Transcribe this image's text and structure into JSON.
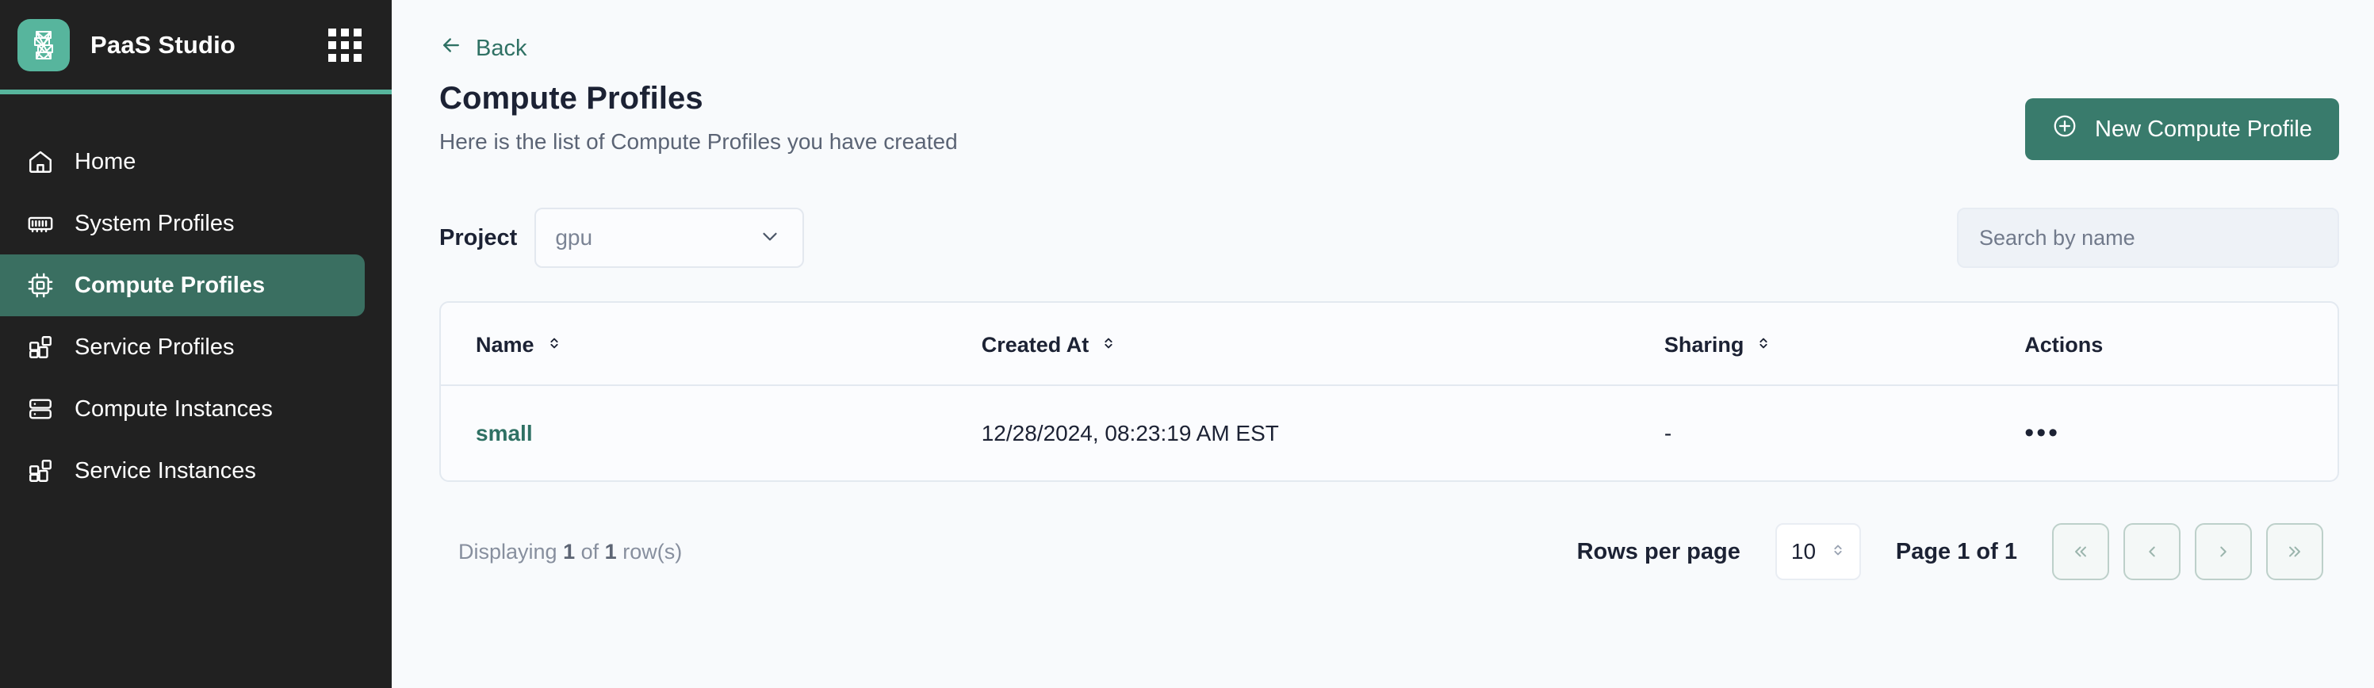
{
  "brand": {
    "name": "PaaS Studio",
    "logo_icon": "mesh-logo-icon",
    "apps_icon": "apps-grid-icon",
    "accent": "#57b59d"
  },
  "sidebar": {
    "items": [
      {
        "label": "Home",
        "icon": "home-icon",
        "active": false
      },
      {
        "label": "System Profiles",
        "icon": "memory-chip-icon",
        "active": false
      },
      {
        "label": "Compute Profiles",
        "icon": "cpu-icon",
        "active": true
      },
      {
        "label": "Service Profiles",
        "icon": "blocks-icon",
        "active": false
      },
      {
        "label": "Compute Instances",
        "icon": "server-stack-icon",
        "active": false
      },
      {
        "label": "Service Instances",
        "icon": "blocks-icon",
        "active": false
      }
    ],
    "background": "#212121",
    "active_background": "#3a6f61"
  },
  "header": {
    "back_label": "Back",
    "back_icon": "arrow-left-icon",
    "title": "Compute Profiles",
    "subtitle": "Here is the list of Compute Profiles you have created",
    "new_button_label": "New Compute Profile",
    "new_button_icon": "plus-circle-icon",
    "new_button_color": "#397b6c"
  },
  "filters": {
    "project_label": "Project",
    "project_value": "gpu",
    "project_chevron_icon": "chevron-down-icon",
    "search_placeholder": "Search by name",
    "search_value": ""
  },
  "table": {
    "columns": [
      {
        "label": "Name",
        "sortable": true,
        "sort_icon": "sort-chevrons-icon"
      },
      {
        "label": "Created At",
        "sortable": true,
        "sort_icon": "sort-chevrons-icon"
      },
      {
        "label": "Sharing",
        "sortable": true,
        "sort_icon": "sort-chevrons-icon"
      },
      {
        "label": "Actions",
        "sortable": false,
        "sort_icon": ""
      }
    ],
    "rows": [
      {
        "name": "small",
        "created_at": "12/28/2024, 08:23:19 AM EST",
        "sharing": "-",
        "actions_icon": "ellipsis-icon",
        "actions_glyph": "•••"
      }
    ]
  },
  "footer": {
    "displaying_prefix": "Displaying",
    "displaying_count": "1",
    "displaying_middle": "of",
    "displaying_total": "1",
    "displaying_suffix": "row(s)",
    "rows_per_page_label": "Rows per page",
    "rows_per_page_value": "10",
    "rows_per_page_icon": "sort-chevrons-icon",
    "page_label": "Page 1 of 1",
    "pager_buttons": [
      {
        "icon": "chevrons-left-icon",
        "glyph": "«",
        "disabled": true
      },
      {
        "icon": "chevron-left-icon",
        "glyph": "‹",
        "disabled": true
      },
      {
        "icon": "chevron-right-icon",
        "glyph": "›",
        "disabled": true
      },
      {
        "icon": "chevrons-right-icon",
        "glyph": "»",
        "disabled": true
      }
    ]
  }
}
